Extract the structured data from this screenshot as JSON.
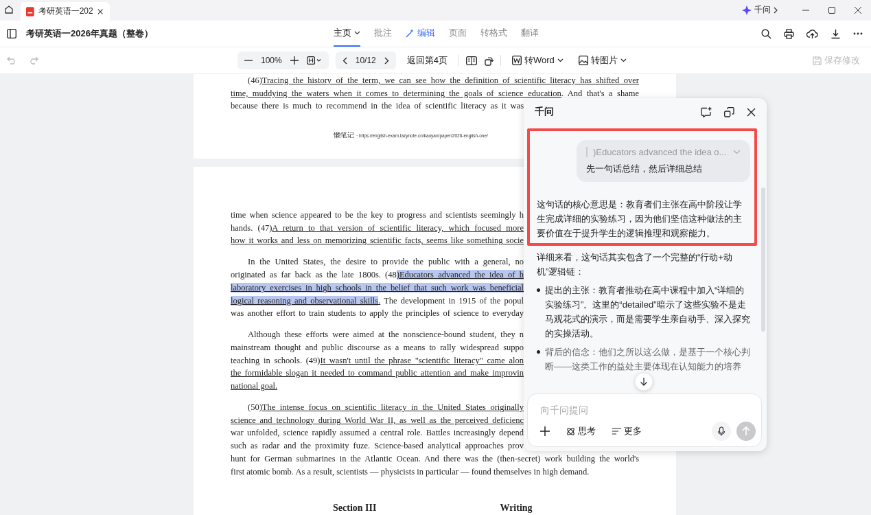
{
  "tab_bar": {
    "tab": {
      "title": "考研英语一202",
      "selected": true
    },
    "assistant_badge": "千问"
  },
  "header": {
    "title": "考研英语一2026年真题（整卷）",
    "tabs": [
      {
        "label": "主页",
        "selected": true,
        "kind": "menu"
      },
      {
        "label": "批注",
        "selected": false,
        "kind": "plain"
      },
      {
        "label": "编辑",
        "selected": false,
        "kind": "magic"
      },
      {
        "label": "页面",
        "selected": false,
        "kind": "plain"
      },
      {
        "label": "转格式",
        "selected": false,
        "kind": "plain"
      },
      {
        "label": "翻译",
        "selected": false,
        "kind": "plain"
      }
    ]
  },
  "toolbar": {
    "undo_disabled": true,
    "redo_disabled": true,
    "zoom": "100%",
    "page": "10/12",
    "back_to_page": "返回第4页",
    "to_word": "转Word",
    "to_image": "转图片",
    "save": {
      "label": "保存修改",
      "disabled": true
    }
  },
  "pages": [
    {
      "paragraphs": [
        {
          "continued": false,
          "lines": [
            {
              "kind": "full",
              "segments": [
                {
                  "text": "(46)",
                  "kind": "plain"
                },
                {
                  "text": "Tracing the history of the term, we can see how the definition of scientific literacy has shifted over",
                  "kind": "underline"
                }
              ]
            },
            {
              "kind": "full",
              "segments": [
                {
                  "text": "time, muddying the waters when it comes to determining the goals of science education",
                  "kind": "underline"
                },
                {
                  "text": ". And that's a shame",
                  "kind": "plain"
                }
              ]
            },
            {
              "kind": "cut",
              "segments": [
                {
                  "text": "because there is much to recommend in the idea of scientific literacy as it was",
                  "kind": "plain"
                }
              ]
            }
          ]
        }
      ],
      "source_label": "懒笔记",
      "source_url": "· https://english-exam.lazynote.cn/kaoyan/paper/2026-english-one/"
    },
    {
      "paragraphs": [
        {
          "continued": true,
          "lines": [
            {
              "kind": "cut",
              "segments": [
                {
                  "text": "time when science appeared to be the key to progress and scientists seemingly h",
                  "kind": "plain"
                }
              ]
            },
            {
              "kind": "cut",
              "segments": [
                {
                  "text": "hands. (47)",
                  "kind": "plain"
                },
                {
                  "text": "A return to that version of scientific literacy, which focused more",
                  "kind": "underline"
                }
              ]
            },
            {
              "kind": "cut",
              "segments": [
                {
                  "text": "how it works and less on memorizing scientific facts, seems like something socie",
                  "kind": "underline"
                }
              ]
            }
          ]
        },
        {
          "continued": false,
          "lines": [
            {
              "kind": "cut",
              "segments": [
                {
                  "text": "In the United States, the desire to provide the public with a general, no",
                  "kind": "plain"
                }
              ]
            },
            {
              "kind": "cut",
              "segments": [
                {
                  "text": "originated as far back as the late 1800s. (48",
                  "kind": "plain"
                },
                {
                  "text": ")Educators advanced the idea of h",
                  "kind": "highlight"
                }
              ]
            },
            {
              "kind": "cut",
              "segments": [
                {
                  "text": "laboratory exercises in high schools in the belief that such work was beneficial",
                  "kind": "highlight"
                }
              ]
            },
            {
              "kind": "cut",
              "segments": [
                {
                  "text": "logical reasoning and observational skills",
                  "kind": "highlight"
                },
                {
                  "text": ".",
                  "kind": "underline"
                },
                {
                  "text": " The development in 1915 of the popul",
                  "kind": "plain"
                }
              ]
            },
            {
              "kind": "cut",
              "segments": [
                {
                  "text": "was another effort to train students to apply the principles of science to everyday",
                  "kind": "plain"
                }
              ]
            }
          ]
        },
        {
          "continued": false,
          "lines": [
            {
              "kind": "cut",
              "segments": [
                {
                  "text": "Although these efforts were aimed at the nonscience-bound student, they n",
                  "kind": "plain"
                }
              ]
            },
            {
              "kind": "cut",
              "segments": [
                {
                  "text": "mainstream thought and public discourse as a means to rally widespread suppo",
                  "kind": "plain"
                }
              ]
            },
            {
              "kind": "cut",
              "segments": [
                {
                  "text": "teaching in schools. (49)",
                  "kind": "plain"
                },
                {
                  "text": "It wasn't until the phrase \"scientific literacy\" came alon",
                  "kind": "underline"
                }
              ]
            },
            {
              "kind": "cut",
              "segments": [
                {
                  "text": "the formidable slogan it needed to command public attention and make improvin",
                  "kind": "underline"
                }
              ]
            },
            {
              "kind": "last",
              "segments": [
                {
                  "text": "national goal.",
                  "kind": "underline"
                }
              ]
            }
          ]
        },
        {
          "continued": false,
          "lines": [
            {
              "kind": "cut",
              "segments": [
                {
                  "text": "(50)",
                  "kind": "plain"
                },
                {
                  "text": "The intense focus on scientific literacy in the United States originally",
                  "kind": "underline"
                }
              ]
            },
            {
              "kind": "cut",
              "segments": [
                {
                  "text": "science and technology during World War II, as well as the perceived deficienc",
                  "kind": "underline"
                }
              ]
            },
            {
              "kind": "cut",
              "segments": [
                {
                  "text": "war unfolded, science rapidly assumed a central role. Battles increasingly depend",
                  "kind": "plain"
                }
              ]
            },
            {
              "kind": "cut",
              "segments": [
                {
                  "text": "such as radar and the proximity fuze. Science-based analytical approaches prov",
                  "kind": "plain"
                }
              ]
            },
            {
              "kind": "full",
              "segments": [
                {
                  "text": "hunt for German submarines in the Atlantic Ocean. And there was the (then-secret) work building the world's",
                  "kind": "plain"
                }
              ]
            },
            {
              "kind": "last",
              "segments": [
                {
                  "text": "first atomic bomb. As a result, scientists — physicists in particular — found themselves in high demand.",
                  "kind": "plain"
                }
              ]
            }
          ]
        }
      ],
      "headings": [
        "Section III",
        "Writing"
      ]
    }
  ],
  "assistant": {
    "title": "千问",
    "quote": ")Educators advanced the idea o...",
    "question": "先一句话总结，然后详细总结",
    "summary": "这句话的核心意思是：教育者们主张在高中阶段让学生完成详细的实验练习，因为他们坚信这种做法的主要价值在于提升学生的逻辑推理和观察能力。",
    "detail_intro": "详细来看，这句话其实包含了一个完整的“行动+动机”逻辑链：",
    "bullets": [
      "提出的主张：教育者推动在高中课程中加入“详细的实验练习”。这里的“detailed”暗示了这些实验不是走马观花式的演示，而是需要学生亲自动手、深入探究的实操活动。",
      "背后的信念：他们之所以这么做，是基于一个核心判断——这类工作的益处主要体现在认知能力的培养"
    ],
    "input": {
      "placeholder": "向千问提问"
    },
    "think": "思考",
    "more": "更多"
  }
}
